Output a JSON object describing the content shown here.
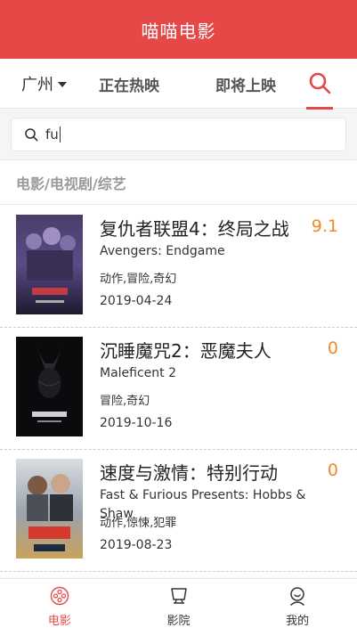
{
  "header": {
    "title": "喵喵电影"
  },
  "nav": {
    "city": "广州",
    "tab_hot": "正在热映",
    "tab_soon": "即将上映"
  },
  "search": {
    "value": "fu"
  },
  "section": {
    "title": "电影/电视剧/综艺"
  },
  "movies": [
    {
      "title": "复仇者联盟4：终局之战",
      "score": "9.1",
      "en_name": "Avengers: Endgame",
      "genre": "动作,冒险,奇幻",
      "date": "2019-04-24"
    },
    {
      "title": "沉睡魔咒2：恶魔夫人",
      "score": "0",
      "en_name": "Maleficent 2",
      "genre": "冒险,奇幻",
      "date": "2019-10-16"
    },
    {
      "title": "速度与激情：特别行动",
      "score": "0",
      "en_name": "Fast & Furious Presents: Hobbs &",
      "en_name_overflow": "Shaw",
      "genre": "动作,惊悚,犯罪",
      "date": "2019-08-23"
    }
  ],
  "footer": {
    "tab_movie": "电影",
    "tab_cinema": "影院",
    "tab_mine": "我的"
  },
  "colors": {
    "brand": "#e54847",
    "score": "#f08a24"
  }
}
